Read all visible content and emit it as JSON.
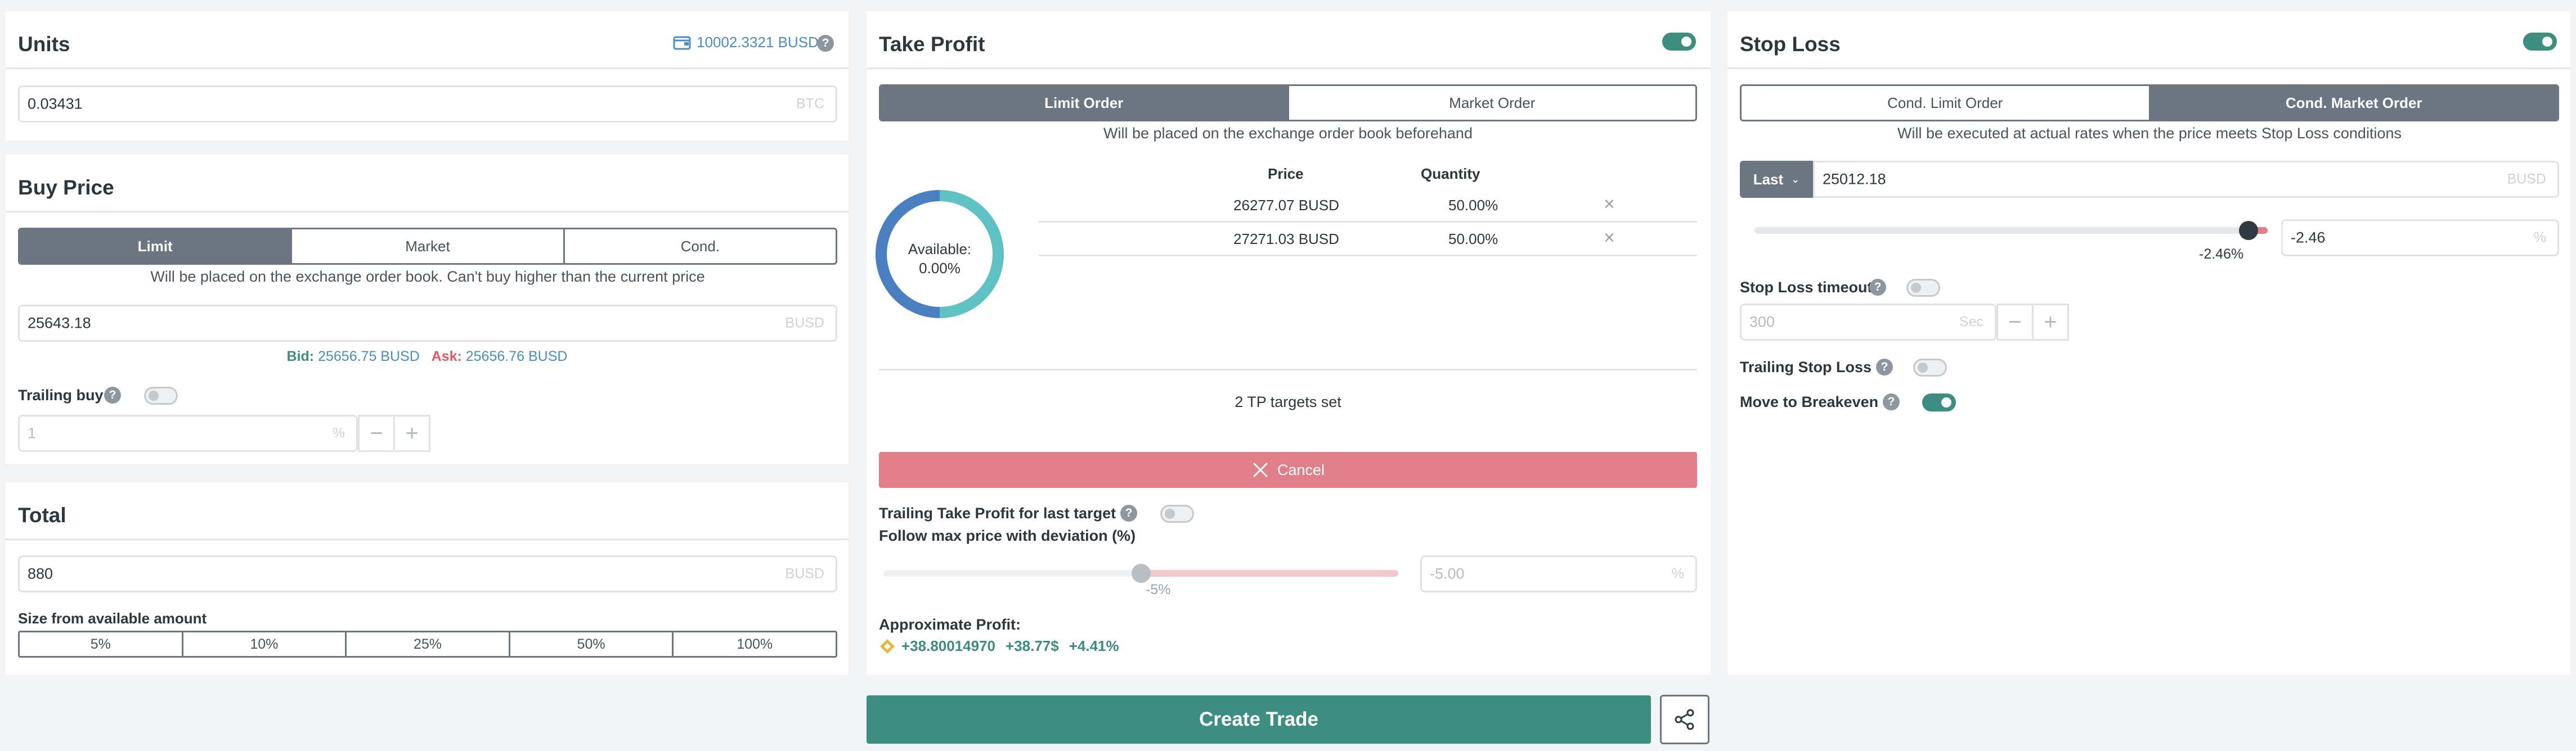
{
  "units": {
    "title": "Units",
    "balance": "10002.3321 BUSD",
    "value": "0.03431",
    "unit": "BTC"
  },
  "buy_price": {
    "title": "Buy Price",
    "tabs": [
      "Limit",
      "Market",
      "Cond."
    ],
    "active_tab": "Limit",
    "note": "Will be placed on the exchange order book. Can't buy higher than the current price",
    "value": "25643.18",
    "unit": "BUSD",
    "bid_label": "Bid:",
    "bid_value": "25656.75 BUSD",
    "ask_label": "Ask:",
    "ask_value": "25656.76 BUSD",
    "trailing_label": "Trailing buy",
    "trailing_on": false,
    "trailing_value": "1",
    "trailing_unit": "%"
  },
  "total": {
    "title": "Total",
    "value": "880",
    "unit": "BUSD",
    "size_label": "Size from available amount",
    "percents": [
      "5%",
      "10%",
      "25%",
      "50%",
      "100%"
    ]
  },
  "take_profit": {
    "title": "Take Profit",
    "enabled": true,
    "tabs": [
      "Limit Order",
      "Market Order"
    ],
    "active_tab": "Limit Order",
    "note": "Will be placed on the exchange order book beforehand",
    "donut_label": "Available:",
    "donut_value": "0.00%",
    "table_headers": [
      "Price",
      "Quantity"
    ],
    "targets": [
      {
        "price": "26277.07 BUSD",
        "quantity": "50.00%"
      },
      {
        "price": "27271.03 BUSD",
        "quantity": "50.00%"
      }
    ],
    "targets_summary": "2 TP targets set",
    "cancel_label": "Cancel",
    "trailing_label": "Trailing Take Profit for last target",
    "trailing_on": false,
    "follow_label": "Follow max price with deviation (%)",
    "slider_value_label": "-5%",
    "slider_fraction": 0.5,
    "deviation_value": "-5.00",
    "deviation_unit": "%",
    "approx_label": "Approximate Profit:",
    "profit_coin": "+38.80014970",
    "profit_usd": "+38.77$",
    "profit_pct": "+4.41%"
  },
  "stop_loss": {
    "title": "Stop Loss",
    "enabled": true,
    "tabs": [
      "Cond. Limit Order",
      "Cond. Market Order"
    ],
    "active_tab": "Cond. Market Order",
    "note": "Will be executed at actual rates when the price meets Stop Loss conditions",
    "price_type": "Last",
    "value": "25012.18",
    "unit": "BUSD",
    "slider_value_label": "-2.46%",
    "percent_value": "-2.46",
    "percent_unit": "%",
    "timeout_label": "Stop Loss timeout",
    "timeout_on": false,
    "timeout_value": "300",
    "timeout_unit": "Sec",
    "trailing_label": "Trailing Stop Loss",
    "trailing_on": false,
    "breakeven_label": "Move to Breakeven",
    "breakeven_on": true
  },
  "actions": {
    "create_label": "Create Trade"
  },
  "colors": {
    "accent": "#3c8e80",
    "cancel": "#e07f88",
    "segment": "#6b7681"
  }
}
